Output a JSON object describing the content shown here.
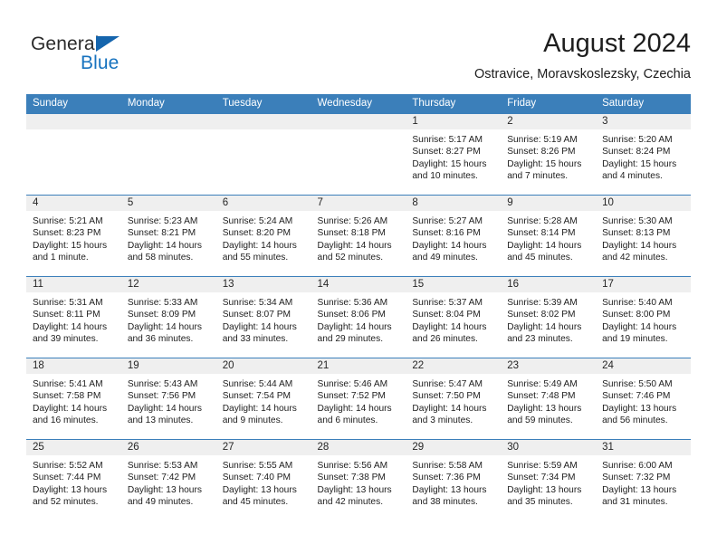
{
  "branding": {
    "name_primary": "General",
    "name_secondary": "Blue",
    "triangle_icon": "triangle-icon",
    "accent_blue": "#1773bf"
  },
  "header": {
    "title": "August 2024",
    "location": "Ostravice, Moravskoslezsky, Czechia"
  },
  "colors": {
    "header_blue": "#3b7fba",
    "daynum_band": "#efefef",
    "text": "#1d1d1d"
  },
  "calendar": {
    "month": "August",
    "year": "2024",
    "weekday_headers": [
      "Sunday",
      "Monday",
      "Tuesday",
      "Wednesday",
      "Thursday",
      "Friday",
      "Saturday"
    ],
    "weeks": [
      [
        {
          "day": "",
          "lines": []
        },
        {
          "day": "",
          "lines": []
        },
        {
          "day": "",
          "lines": []
        },
        {
          "day": "",
          "lines": []
        },
        {
          "day": "1",
          "lines": [
            "Sunrise: 5:17 AM",
            "Sunset: 8:27 PM",
            "Daylight: 15 hours",
            "and 10 minutes."
          ]
        },
        {
          "day": "2",
          "lines": [
            "Sunrise: 5:19 AM",
            "Sunset: 8:26 PM",
            "Daylight: 15 hours",
            "and 7 minutes."
          ]
        },
        {
          "day": "3",
          "lines": [
            "Sunrise: 5:20 AM",
            "Sunset: 8:24 PM",
            "Daylight: 15 hours",
            "and 4 minutes."
          ]
        }
      ],
      [
        {
          "day": "4",
          "lines": [
            "Sunrise: 5:21 AM",
            "Sunset: 8:23 PM",
            "Daylight: 15 hours",
            "and 1 minute."
          ]
        },
        {
          "day": "5",
          "lines": [
            "Sunrise: 5:23 AM",
            "Sunset: 8:21 PM",
            "Daylight: 14 hours",
            "and 58 minutes."
          ]
        },
        {
          "day": "6",
          "lines": [
            "Sunrise: 5:24 AM",
            "Sunset: 8:20 PM",
            "Daylight: 14 hours",
            "and 55 minutes."
          ]
        },
        {
          "day": "7",
          "lines": [
            "Sunrise: 5:26 AM",
            "Sunset: 8:18 PM",
            "Daylight: 14 hours",
            "and 52 minutes."
          ]
        },
        {
          "day": "8",
          "lines": [
            "Sunrise: 5:27 AM",
            "Sunset: 8:16 PM",
            "Daylight: 14 hours",
            "and 49 minutes."
          ]
        },
        {
          "day": "9",
          "lines": [
            "Sunrise: 5:28 AM",
            "Sunset: 8:14 PM",
            "Daylight: 14 hours",
            "and 45 minutes."
          ]
        },
        {
          "day": "10",
          "lines": [
            "Sunrise: 5:30 AM",
            "Sunset: 8:13 PM",
            "Daylight: 14 hours",
            "and 42 minutes."
          ]
        }
      ],
      [
        {
          "day": "11",
          "lines": [
            "Sunrise: 5:31 AM",
            "Sunset: 8:11 PM",
            "Daylight: 14 hours",
            "and 39 minutes."
          ]
        },
        {
          "day": "12",
          "lines": [
            "Sunrise: 5:33 AM",
            "Sunset: 8:09 PM",
            "Daylight: 14 hours",
            "and 36 minutes."
          ]
        },
        {
          "day": "13",
          "lines": [
            "Sunrise: 5:34 AM",
            "Sunset: 8:07 PM",
            "Daylight: 14 hours",
            "and 33 minutes."
          ]
        },
        {
          "day": "14",
          "lines": [
            "Sunrise: 5:36 AM",
            "Sunset: 8:06 PM",
            "Daylight: 14 hours",
            "and 29 minutes."
          ]
        },
        {
          "day": "15",
          "lines": [
            "Sunrise: 5:37 AM",
            "Sunset: 8:04 PM",
            "Daylight: 14 hours",
            "and 26 minutes."
          ]
        },
        {
          "day": "16",
          "lines": [
            "Sunrise: 5:39 AM",
            "Sunset: 8:02 PM",
            "Daylight: 14 hours",
            "and 23 minutes."
          ]
        },
        {
          "day": "17",
          "lines": [
            "Sunrise: 5:40 AM",
            "Sunset: 8:00 PM",
            "Daylight: 14 hours",
            "and 19 minutes."
          ]
        }
      ],
      [
        {
          "day": "18",
          "lines": [
            "Sunrise: 5:41 AM",
            "Sunset: 7:58 PM",
            "Daylight: 14 hours",
            "and 16 minutes."
          ]
        },
        {
          "day": "19",
          "lines": [
            "Sunrise: 5:43 AM",
            "Sunset: 7:56 PM",
            "Daylight: 14 hours",
            "and 13 minutes."
          ]
        },
        {
          "day": "20",
          "lines": [
            "Sunrise: 5:44 AM",
            "Sunset: 7:54 PM",
            "Daylight: 14 hours",
            "and 9 minutes."
          ]
        },
        {
          "day": "21",
          "lines": [
            "Sunrise: 5:46 AM",
            "Sunset: 7:52 PM",
            "Daylight: 14 hours",
            "and 6 minutes."
          ]
        },
        {
          "day": "22",
          "lines": [
            "Sunrise: 5:47 AM",
            "Sunset: 7:50 PM",
            "Daylight: 14 hours",
            "and 3 minutes."
          ]
        },
        {
          "day": "23",
          "lines": [
            "Sunrise: 5:49 AM",
            "Sunset: 7:48 PM",
            "Daylight: 13 hours",
            "and 59 minutes."
          ]
        },
        {
          "day": "24",
          "lines": [
            "Sunrise: 5:50 AM",
            "Sunset: 7:46 PM",
            "Daylight: 13 hours",
            "and 56 minutes."
          ]
        }
      ],
      [
        {
          "day": "25",
          "lines": [
            "Sunrise: 5:52 AM",
            "Sunset: 7:44 PM",
            "Daylight: 13 hours",
            "and 52 minutes."
          ]
        },
        {
          "day": "26",
          "lines": [
            "Sunrise: 5:53 AM",
            "Sunset: 7:42 PM",
            "Daylight: 13 hours",
            "and 49 minutes."
          ]
        },
        {
          "day": "27",
          "lines": [
            "Sunrise: 5:55 AM",
            "Sunset: 7:40 PM",
            "Daylight: 13 hours",
            "and 45 minutes."
          ]
        },
        {
          "day": "28",
          "lines": [
            "Sunrise: 5:56 AM",
            "Sunset: 7:38 PM",
            "Daylight: 13 hours",
            "and 42 minutes."
          ]
        },
        {
          "day": "29",
          "lines": [
            "Sunrise: 5:58 AM",
            "Sunset: 7:36 PM",
            "Daylight: 13 hours",
            "and 38 minutes."
          ]
        },
        {
          "day": "30",
          "lines": [
            "Sunrise: 5:59 AM",
            "Sunset: 7:34 PM",
            "Daylight: 13 hours",
            "and 35 minutes."
          ]
        },
        {
          "day": "31",
          "lines": [
            "Sunrise: 6:00 AM",
            "Sunset: 7:32 PM",
            "Daylight: 13 hours",
            "and 31 minutes."
          ]
        }
      ]
    ]
  }
}
